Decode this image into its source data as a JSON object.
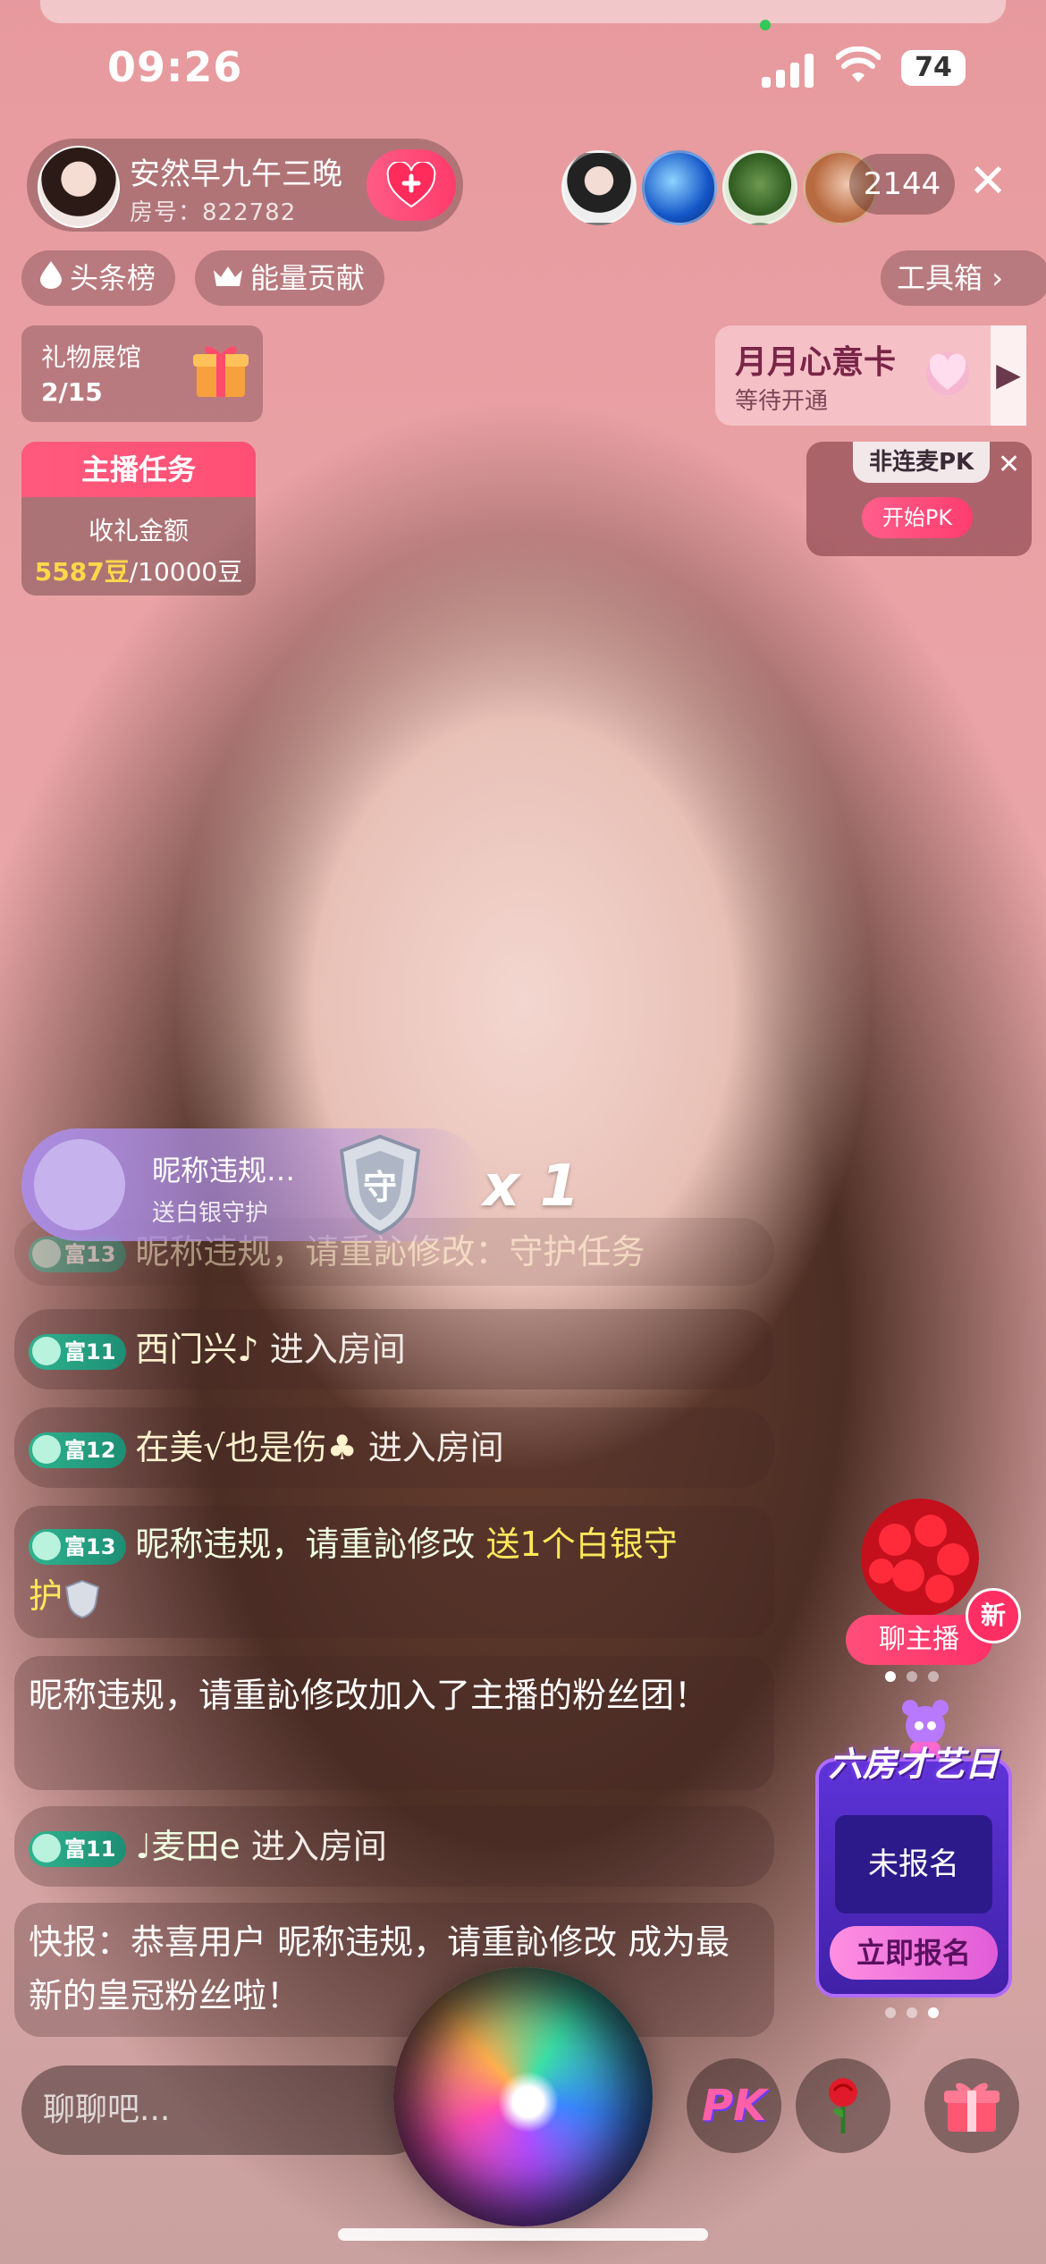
{
  "status_bar": {
    "time": "09:26",
    "battery": "74"
  },
  "host": {
    "name": "安然早九午三晚",
    "room": "房号：822782"
  },
  "viewers": {
    "count": "2144"
  },
  "chips": {
    "rank": "头条榜",
    "energy": "能量贡献",
    "toolbox": "工具箱"
  },
  "gift_hall": {
    "title": "礼物展馆",
    "progress": "2/15"
  },
  "task": {
    "title": "主播任务",
    "subtitle": "收礼金额",
    "current": "5587豆",
    "target": "/10000豆"
  },
  "month_card": {
    "title": "月月心意卡",
    "status": "等待开通"
  },
  "pk": {
    "tag": "非连麦PK",
    "button": "开始PK"
  },
  "gift_banner": {
    "name": "昵称违规…",
    "action": "送白银守护",
    "multiplier": "x 1"
  },
  "chat": {
    "faded": {
      "badge": "富13",
      "text": "昵称违规，请重訫修改：守护任务"
    },
    "m1": {
      "badge": "富11",
      "name": "西门兴♪",
      "action": "进入房间"
    },
    "m2": {
      "badge": "富12",
      "name": "在美√也是伤♣",
      "action": "进入房间"
    },
    "m3": {
      "badge": "富13",
      "name": "昵称违规，请重訫修改",
      "action": "送1个白银守",
      "action2": "护"
    },
    "m4": {
      "text": "昵称违规，请重訫修改加入了主播的粉丝团！"
    },
    "m5": {
      "badge": "富11",
      "name": "♩麦田e",
      "action": "进入房间"
    },
    "m6": {
      "text": "快报：恭喜用户 昵称违规，请重訫修改 成为最新的皇冠粉丝啦！"
    }
  },
  "side": {
    "chat_host": "聊主播",
    "new": "新",
    "event_title": "六房才艺日",
    "event_status": "未报名",
    "event_button": "立即报名"
  },
  "input": {
    "placeholder": "聊聊吧..."
  },
  "bottom": {
    "pk": "PK"
  }
}
